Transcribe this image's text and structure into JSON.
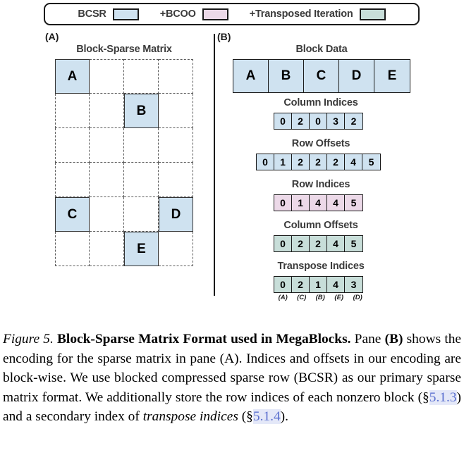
{
  "legend": {
    "entries": [
      {
        "label": "BCSR",
        "color": "#cfe2f0"
      },
      {
        "label": "+BCOO",
        "color": "#ecd9e8"
      },
      {
        "label": "+Transposed Iteration",
        "color": "#c8ded9"
      }
    ]
  },
  "panes": {
    "a": {
      "tag": "(A)",
      "title": "Block-Sparse Matrix",
      "grid": {
        "rows": 6,
        "cols": 4
      },
      "blocks": [
        {
          "label": "A",
          "row": 0,
          "col": 0
        },
        {
          "label": "B",
          "row": 1,
          "col": 2
        },
        {
          "label": "C",
          "row": 4,
          "col": 0
        },
        {
          "label": "D",
          "row": 4,
          "col": 3
        },
        {
          "label": "E",
          "row": 5,
          "col": 2
        }
      ]
    },
    "b": {
      "tag": "(B)",
      "arrays": [
        {
          "name": "block-data",
          "title": "Block Data",
          "values": [
            "A",
            "B",
            "C",
            "D",
            "E"
          ],
          "color": "#cfe2f0"
        },
        {
          "name": "column-indices",
          "title": "Column Indices",
          "values": [
            "0",
            "2",
            "0",
            "3",
            "2"
          ],
          "color": "#cfe2f0"
        },
        {
          "name": "row-offsets",
          "title": "Row Offsets",
          "values": [
            "0",
            "1",
            "2",
            "2",
            "2",
            "4",
            "5"
          ],
          "color": "#cfe2f0"
        },
        {
          "name": "row-indices",
          "title": "Row Indices",
          "values": [
            "0",
            "1",
            "4",
            "4",
            "5"
          ],
          "color": "#ecd9e8"
        },
        {
          "name": "column-offsets",
          "title": "Column Offsets",
          "values": [
            "0",
            "2",
            "2",
            "4",
            "5"
          ],
          "color": "#c8ded9"
        },
        {
          "name": "transpose-indices",
          "title": "Transpose Indices",
          "values": [
            "0",
            "2",
            "1",
            "4",
            "3"
          ],
          "sublabels": [
            "(A)",
            "(C)",
            "(B)",
            "(E)",
            "(D)"
          ],
          "color": "#c8ded9"
        }
      ]
    }
  },
  "caption": {
    "figure_number": "Figure 5.",
    "headline": "Block-Sparse Matrix Format used in MegaBlocks.",
    "body_1": "Pane ",
    "body_b": "(B)",
    "body_2": " shows the encoding for the sparse matrix in pane (A). Indices and offsets in our encoding are block-wise. We use blocked compressed sparse row (BCSR) as our primary sparse matrix format. We additionally store the row indices of each nonzero block (§",
    "xref_1": "5.1.3",
    "body_3": ") and a secondary index of ",
    "emph": "transpose indices",
    "body_4": " (§",
    "xref_2": "5.1.4",
    "body_5": ")."
  },
  "colors": {
    "bcsr": "#cfe2f0",
    "bcoo": "#ecd9e8",
    "transposed": "#c8ded9",
    "outline": "#1a1a1a",
    "grid_dash": "#5a5a5a",
    "title_text": "#3b3b3b",
    "xref": "#5a6fcf"
  }
}
